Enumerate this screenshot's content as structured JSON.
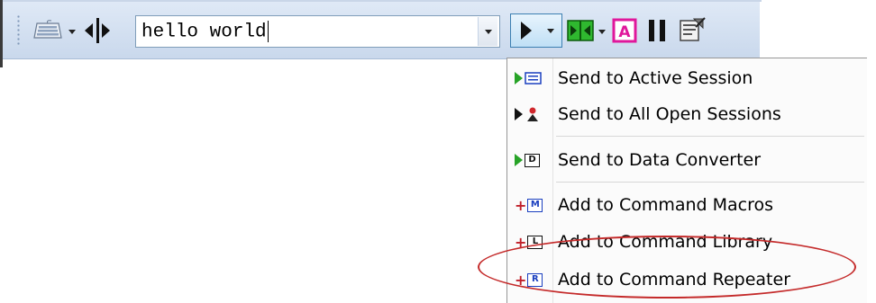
{
  "toolbar": {
    "keyboard_icon": "keyboard-icon",
    "command_value": "hello world",
    "buttons": [
      {
        "name": "send",
        "icon": "play-icon"
      },
      {
        "name": "green-split",
        "icon": "split-icon"
      },
      {
        "name": "pink-a",
        "icon": "letter-a-icon",
        "glyph": "A"
      },
      {
        "name": "pause",
        "icon": "pause-icon"
      },
      {
        "name": "properties",
        "icon": "properties-icon"
      }
    ]
  },
  "menu": {
    "items": [
      {
        "label": "Send to Active Session",
        "icon": "send-active-icon",
        "glyph": "≡"
      },
      {
        "label": "Send to All Open Sessions",
        "icon": "send-all-icon",
        "glyph": "⚇"
      },
      {
        "label": "Send to Data Converter",
        "icon": "send-data-icon",
        "glyph": "D"
      },
      {
        "label": "Add to Command Macros",
        "icon": "add-macro-icon",
        "glyph": "M"
      },
      {
        "label": "Add to Command Library",
        "icon": "add-library-icon",
        "glyph": "L"
      },
      {
        "label": "Add to Command Repeater",
        "icon": "add-repeater-icon",
        "glyph": "R"
      }
    ]
  },
  "colors": {
    "toolbar_bg": "#d3e0f1",
    "highlight": "#c42a2a",
    "green": "#27a327",
    "pink": "#e0179b",
    "icon_blue": "#1a3fbf"
  }
}
